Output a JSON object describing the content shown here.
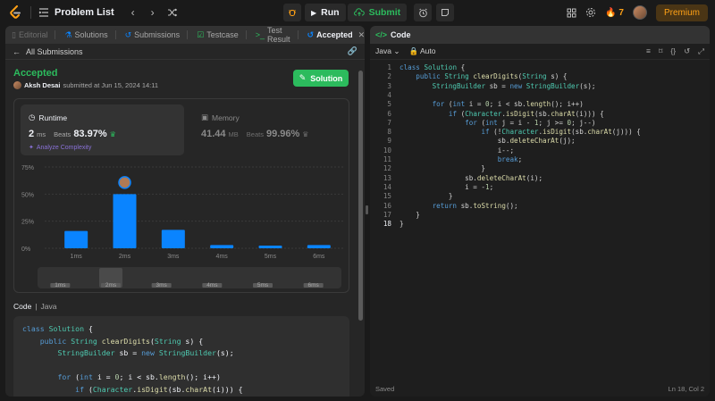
{
  "topbar": {
    "title": "Problem List",
    "run_label": "Run",
    "submit_label": "Submit",
    "streak": "7",
    "premium_label": "Premium"
  },
  "left": {
    "tabs": [
      "Editorial",
      "Solutions",
      "Submissions",
      "Testcase",
      "Test Result",
      "Accepted"
    ],
    "all_submissions": "All Submissions",
    "status": "Accepted",
    "author": "Aksh Desai",
    "submitted_text": "submitted at Jun 15, 2024 14:11",
    "solution_label": "Solution",
    "runtime": {
      "label": "Runtime",
      "value": "2",
      "unit": "ms",
      "beats_label": "Beats",
      "beats": "83.97%",
      "analyze": "Analyze Complexity"
    },
    "memory": {
      "label": "Memory",
      "value": "41.44",
      "unit": "MB",
      "beats_label": "Beats",
      "beats": "99.96%"
    },
    "code_label": "Code",
    "code_lang": "Java",
    "code_preview": [
      "class Solution {",
      "    public String clearDigits(String s) {",
      "        StringBuilder sb = new StringBuilder(s);",
      "",
      "        for (int i = 0; i < sb.length(); i++)",
      "            if (Character.isDigit(sb.charAt(i))) {",
      "                for (int j = i - 1; j >= 0; j--)"
    ]
  },
  "chart_data": {
    "type": "bar",
    "categories": [
      "1ms",
      "2ms",
      "3ms",
      "4ms",
      "5ms",
      "6ms"
    ],
    "values": [
      16,
      50,
      17,
      3,
      2.5,
      3
    ],
    "y_ticks": [
      "75%",
      "50%",
      "25%",
      "0%"
    ],
    "ylim": [
      0,
      75
    ],
    "selected_index": 1,
    "bar_color": "#0a84ff",
    "grid": true
  },
  "right": {
    "title": "Code",
    "language": "Java",
    "mode": "Auto",
    "saved": "Saved",
    "cursor": "Ln 18, Col 2",
    "current_line": 18
  },
  "colors": {
    "accent": "#2cbb5d",
    "brand": "#ffa116",
    "link": "#0a84ff"
  }
}
